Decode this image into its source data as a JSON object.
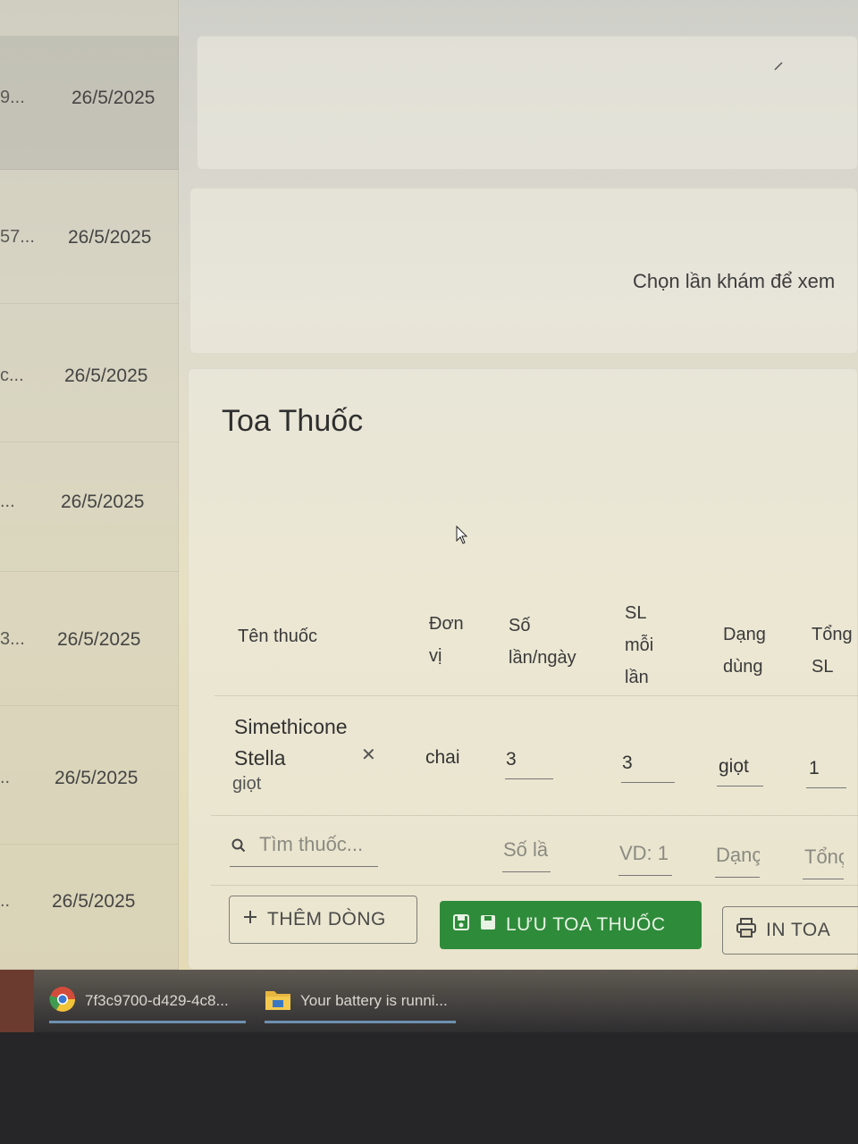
{
  "visits": [
    {
      "id": "9...",
      "date": "26/5/2025"
    },
    {
      "id": "57...",
      "date": "26/5/2025"
    },
    {
      "id": "c...",
      "date": "26/5/2025"
    },
    {
      "id": "...",
      "date": "26/5/2025"
    },
    {
      "id": "3...",
      "date": "26/5/2025"
    },
    {
      "id": "..",
      "date": "26/5/2025"
    },
    {
      "id": "..",
      "date": "26/5/2025"
    }
  ],
  "detail": {
    "hint": "Chọn lần khám để xem"
  },
  "prescription": {
    "title": "Toa Thuốc",
    "columns": {
      "name": "Tên thuốc",
      "unit_1": "Đơn",
      "unit_2": "vị",
      "times_1": "Số",
      "times_2": "lần/ngày",
      "dose_1": "SL",
      "dose_2": "mỗi",
      "dose_3": "lần",
      "form_1": "Dạng",
      "form_2": "dùng",
      "total_1": "Tổng",
      "total_2": "SL"
    },
    "row": {
      "name_line1": "Simethicone",
      "name_line2": "Stella",
      "sub": "giọt",
      "unit": "chai",
      "times_per_day": "3",
      "dose": "3",
      "form": "giọt",
      "total": "1"
    },
    "new_row": {
      "search_placeholder": "Tìm thuốc...",
      "times_placeholder": "Số lầ",
      "dose_placeholder": "VD: 1",
      "form_placeholder": "Dạnç",
      "total_placeholder": "Tổnç"
    },
    "buttons": {
      "add_row": "THÊM DÒNG",
      "save": "LƯU TOA THUỐC",
      "print": "IN TOA"
    }
  },
  "taskbar": {
    "chrome_item": "7f3c9700-d429-4c8...",
    "battery_item": "Your battery is runni..."
  }
}
